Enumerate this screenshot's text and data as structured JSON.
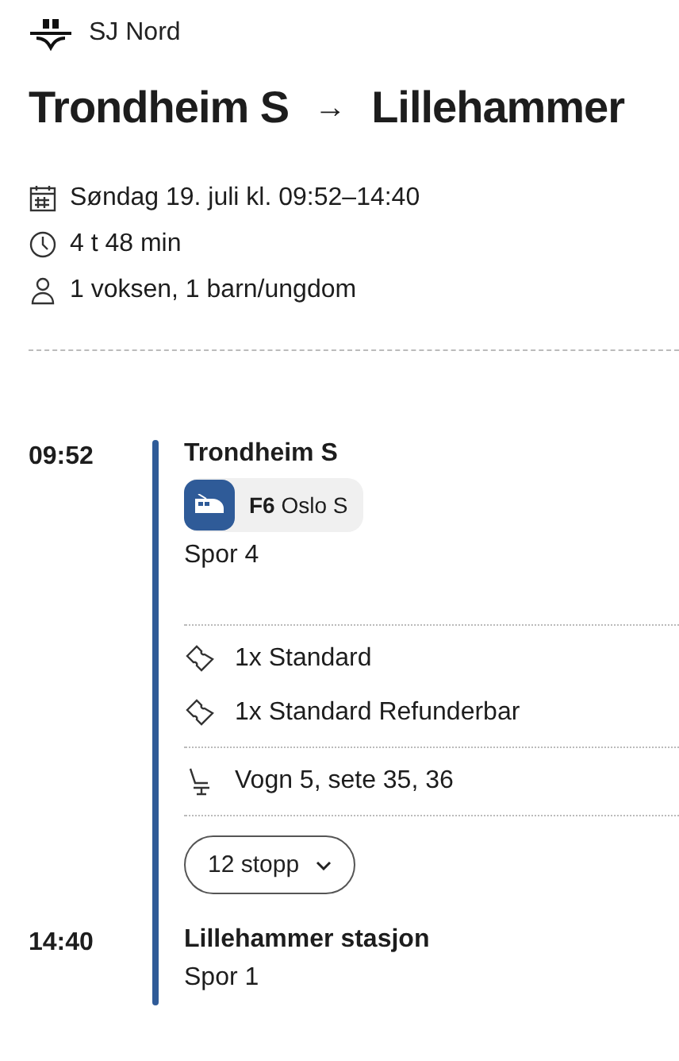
{
  "operator": "SJ Nord",
  "route": {
    "from": "Trondheim S",
    "arrow": "→",
    "to": "Lillehammer"
  },
  "info": [
    {
      "kind": "date",
      "text": "Søndag 19. juli kl. 09:52–14:40"
    },
    {
      "kind": "duration",
      "text": "4 t 48 min"
    },
    {
      "kind": "passengers",
      "text": "1 voksen, 1 barn/ungdom"
    }
  ],
  "departure": {
    "time": "09:52",
    "station": "Trondheim S",
    "line": "F6",
    "destination": "Oslo S",
    "track": "Spor 4"
  },
  "tickets": [
    "1x Standard",
    "1x Standard Refunderbar"
  ],
  "seat": "Vogn 5, sete 35, 36",
  "stops_button": {
    "label": "12 stopp",
    "expanded": false
  },
  "arrival": {
    "time": "14:40",
    "station": "Lillehammer stasjon",
    "track": "Spor 1"
  }
}
